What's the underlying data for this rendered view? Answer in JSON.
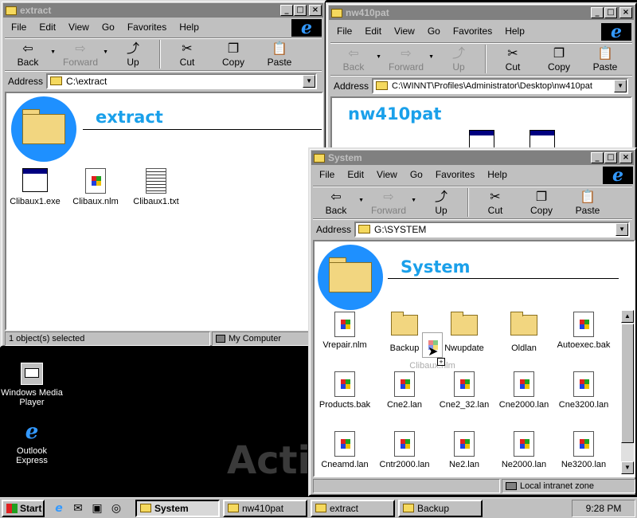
{
  "menu": [
    "File",
    "Edit",
    "View",
    "Go",
    "Favorites",
    "Help"
  ],
  "toolbar": {
    "back": "Back",
    "forward": "Forward",
    "up": "Up",
    "cut": "Cut",
    "copy": "Copy",
    "paste": "Paste"
  },
  "address_label": "Address",
  "windows": {
    "extract": {
      "title": "extract",
      "address": "C:\\extract",
      "folder_title": "extract",
      "files": [
        "Clibaux1.exe",
        "Clibaux.nlm",
        "Clibaux1.txt"
      ],
      "status_left": "1 object(s) selected",
      "status_right": "My Computer"
    },
    "nw410pat": {
      "title": "nw410pat",
      "address": "C:\\WINNT\\Profiles\\Administrator\\Desktop\\nw410pat",
      "folder_title": "nw410pat"
    },
    "system": {
      "title": "System",
      "address": "G:\\SYSTEM",
      "folder_title": "System",
      "files": [
        "Vrepair.nlm",
        "Backup",
        "Nwupdate",
        "Oldlan",
        "Autoexec.bak",
        "Products.bak",
        "Cne2.lan",
        "Cne2_32.lan",
        "Cne2000.lan",
        "Cne3200.lan",
        "Cneamd.lan",
        "Cntr2000.lan",
        "Ne2.lan",
        "Ne2000.lan",
        "Ne3200.lan"
      ],
      "drag_label": "Clibaux.nlm",
      "status_zone": "Local intranet zone"
    }
  },
  "desktop": {
    "media_player": "Windows Media Player",
    "outlook": "Outlook Express",
    "watermark": "Acti"
  },
  "taskbar": {
    "start": "Start",
    "buttons": [
      "System",
      "nw410pat",
      "extract",
      "Backup"
    ],
    "clock": "9:28 PM"
  }
}
